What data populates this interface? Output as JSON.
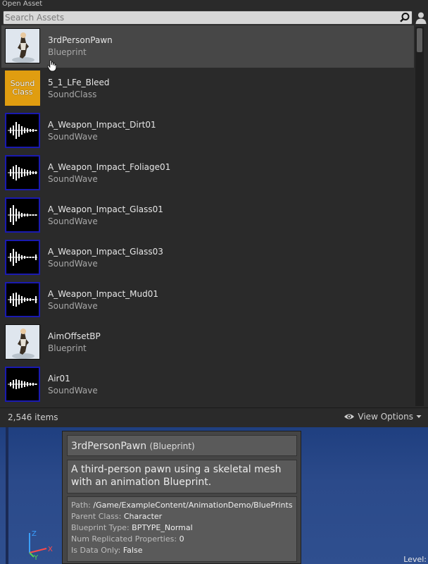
{
  "window": {
    "title": "Open Asset",
    "search": {
      "placeholder": "Search Assets",
      "value": ""
    },
    "search_icon": "search-icon",
    "user_icon": "user-icon"
  },
  "assets": [
    {
      "name": "3rdPersonPawn",
      "type": "Blueprint",
      "thumb": "blueprint",
      "selected": true
    },
    {
      "name": "5_1_LFe_Bleed",
      "type": "SoundClass",
      "thumb": "soundclass",
      "thumb_label": "Sound Class"
    },
    {
      "name": "A_Weapon_Impact_Dirt01",
      "type": "SoundWave",
      "thumb": "soundwave"
    },
    {
      "name": "A_Weapon_Impact_Foliage01",
      "type": "SoundWave",
      "thumb": "soundwave"
    },
    {
      "name": "A_Weapon_Impact_Glass01",
      "type": "SoundWave",
      "thumb": "soundwave"
    },
    {
      "name": "A_Weapon_Impact_Glass03",
      "type": "SoundWave",
      "thumb": "soundwave"
    },
    {
      "name": "A_Weapon_Impact_Mud01",
      "type": "SoundWave",
      "thumb": "soundwave"
    },
    {
      "name": "AimOffsetBP",
      "type": "Blueprint",
      "thumb": "blueprint"
    },
    {
      "name": "Air01",
      "type": "SoundWave",
      "thumb": "soundwave"
    }
  ],
  "footer": {
    "item_count": "2,546 items",
    "view_options": "View Options",
    "eye_icon": "eye-icon",
    "dropdown_icon": "caret-down-icon"
  },
  "viewport": {
    "level_label": "Level:",
    "axis": {
      "x": "X",
      "y": "Y",
      "z": "Z"
    }
  },
  "tooltip": {
    "name": "3rdPersonPawn",
    "class_label": "(Blueprint)",
    "description": "A third-person pawn using a skeletal mesh with an animation Blueprint.",
    "properties": [
      {
        "key": "Path:",
        "value": "/Game/ExampleContent/AnimationDemo/BluePrints"
      },
      {
        "key": "Parent Class:",
        "value": "Character"
      },
      {
        "key": "Blueprint Type:",
        "value": "BPTYPE_Normal"
      },
      {
        "key": "Num Replicated Properties:",
        "value": "0"
      },
      {
        "key": "Is Data Only:",
        "value": "False"
      }
    ]
  },
  "colors": {
    "panel": "#2a2a2a",
    "selected_row": "#474747",
    "soundclass_thumb": "#e09d10",
    "soundwave_border": "#1a1ab0",
    "viewport": "#2b4a8a"
  }
}
